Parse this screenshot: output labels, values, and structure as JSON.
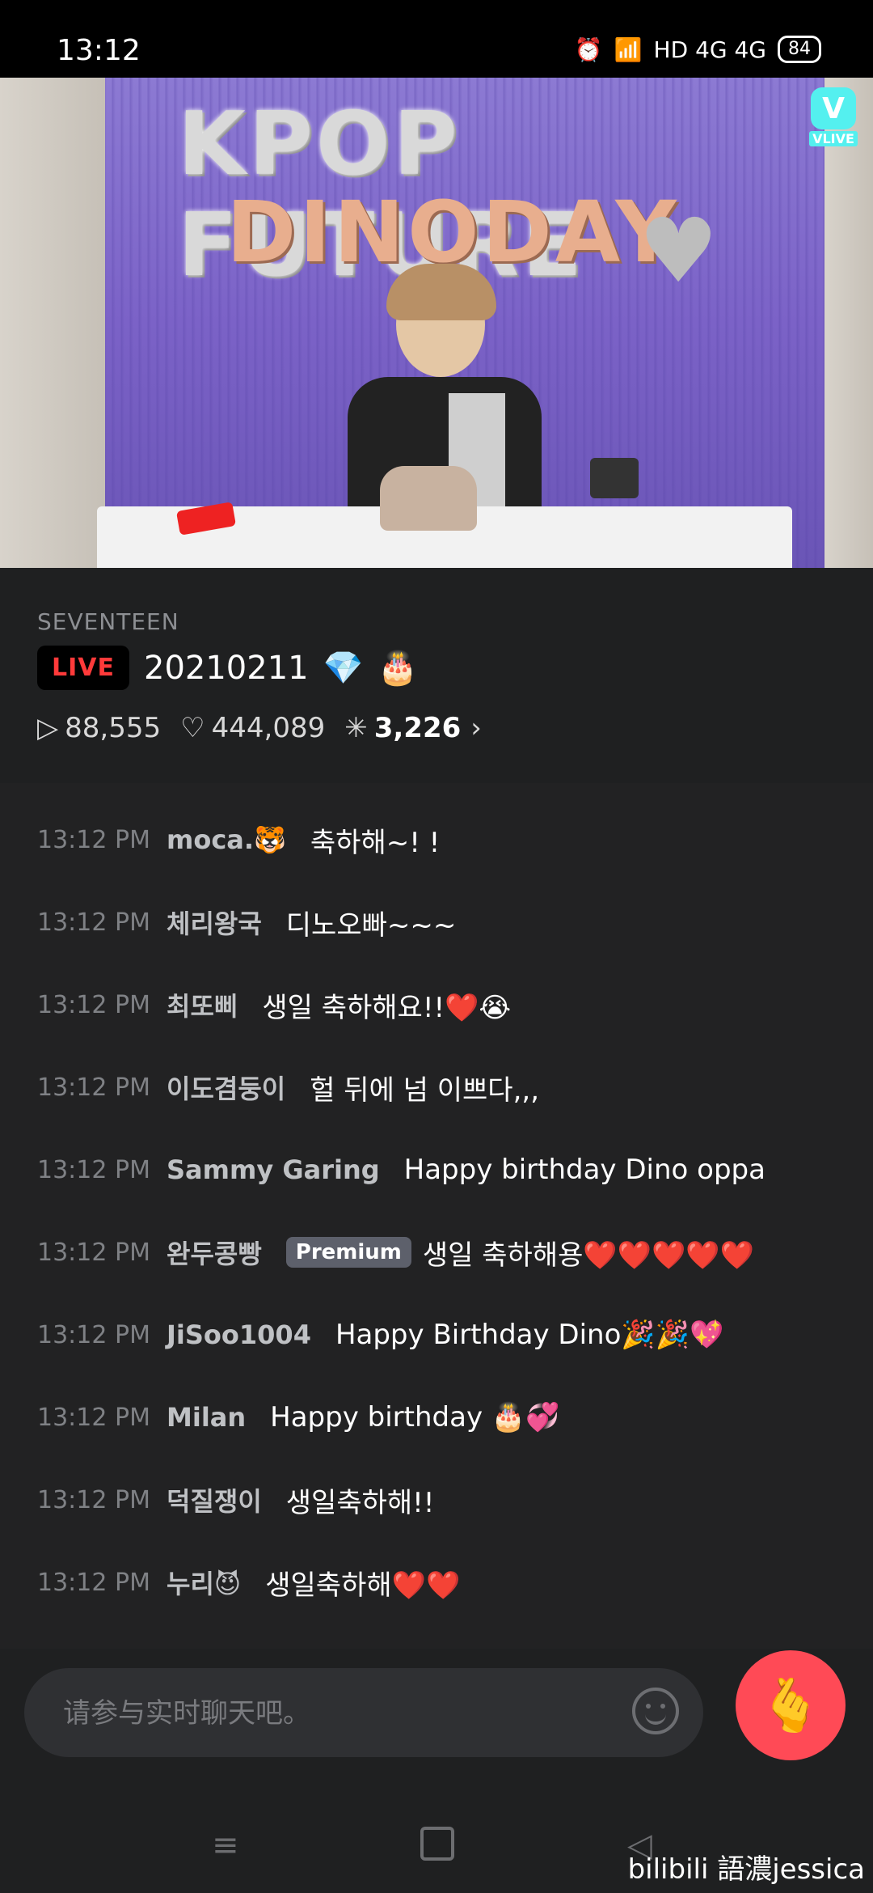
{
  "status_bar": {
    "time": "13:12",
    "network": "HD 4G 4G",
    "battery": "84"
  },
  "video": {
    "balloon_line1": "KPOP FUTURE",
    "balloon_line2": "DINODAY",
    "logo_text": "VLIVE"
  },
  "stream": {
    "channel": "SEVENTEEN",
    "live_label": "LIVE",
    "title": "20210211",
    "views": "88,555",
    "likes": "444,089",
    "chat_count": "3,226"
  },
  "chat": [
    {
      "time": "13:12 PM",
      "user": "moca.🐯",
      "text": "축하해~! !",
      "premium": ""
    },
    {
      "time": "13:12 PM",
      "user": "체리왕국",
      "text": "디노오빠~~~",
      "premium": ""
    },
    {
      "time": "13:12 PM",
      "user": "최또삐",
      "text": "생일 축하해요!!❤️😭",
      "premium": ""
    },
    {
      "time": "13:12 PM",
      "user": "이도겸둥이",
      "text": "헐 뒤에 넘 이쁘다,,,",
      "premium": ""
    },
    {
      "time": "13:12 PM",
      "user": "Sammy Garing",
      "text": "Happy birthday Dino oppa",
      "premium": ""
    },
    {
      "time": "13:12 PM",
      "user": "완두콩빵",
      "text": "생일 축하해용❤️❤️❤️❤️❤️",
      "premium": "Premium"
    },
    {
      "time": "13:12 PM",
      "user": "JiSoo1004",
      "text": "Happy Birthday Dino🎉🎉💖",
      "premium": ""
    },
    {
      "time": "13:12 PM",
      "user": "Milan",
      "text": "Happy birthday 🎂💞",
      "premium": ""
    },
    {
      "time": "13:12 PM",
      "user": "덕질쟁이",
      "text": "생일축하해!!",
      "premium": ""
    },
    {
      "time": "13:12 PM",
      "user": "누리😈",
      "text": "생일축하해❤️❤️",
      "premium": ""
    }
  ],
  "input": {
    "placeholder": "请参与实时聊天吧。"
  },
  "watermark": "bilibili 語濃jessica",
  "colors": {
    "live_red": "#ff3a3a",
    "heart_button": "#ff4a56",
    "vlive_cyan": "#54f0ef"
  }
}
